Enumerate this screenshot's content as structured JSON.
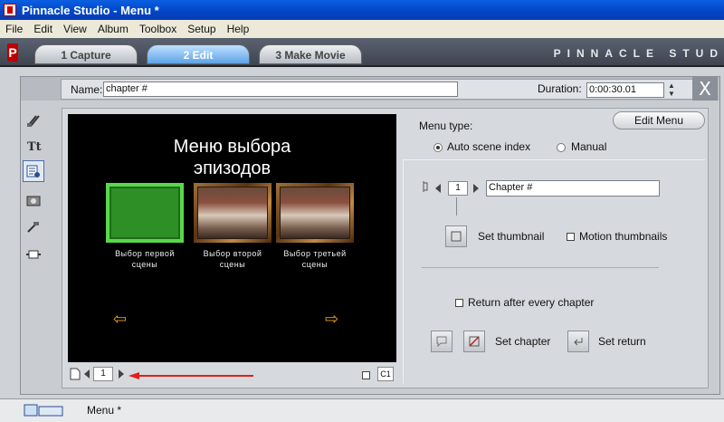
{
  "window": {
    "title": "Pinnacle Studio - Menu *"
  },
  "menubar": [
    "File",
    "Edit",
    "View",
    "Album",
    "Toolbox",
    "Setup",
    "Help"
  ],
  "tabs": [
    {
      "label": "1 Capture",
      "active": false
    },
    {
      "label": "2 Edit",
      "active": true
    },
    {
      "label": "3 Make Movie",
      "active": false
    }
  ],
  "brand": "PINNACLE STUD",
  "logo_letter": "P",
  "editor": {
    "name_label": "Name:",
    "name_value": "chapter #",
    "duration_label": "Duration:",
    "duration_value": "0:00:30.01",
    "close_glyph": "X"
  },
  "tools": [
    {
      "icon": "video-toolbox-icon"
    },
    {
      "icon": "title-toolbox-icon"
    },
    {
      "icon": "menu-toolbox-icon",
      "selected": true
    },
    {
      "icon": "photo-toolbox-icon"
    },
    {
      "icon": "audio-toolbox-icon"
    },
    {
      "icon": "effects-toolbox-icon"
    }
  ],
  "preview": {
    "title_line1": "Меню выбора",
    "title_line2": "эпизодов",
    "captions": [
      {
        "line1": "Выбор первой",
        "line2": "сцены"
      },
      {
        "line1": "Выбор второй",
        "line2": "сцены"
      },
      {
        "line1": "Выбор третьей",
        "line2": "сцены"
      }
    ],
    "page_number": "1",
    "chapter_badge": "C1"
  },
  "menu_settings": {
    "menu_type_label": "Menu type:",
    "edit_menu_button": "Edit Menu",
    "options": [
      {
        "label": "Auto scene index",
        "selected": true
      },
      {
        "label": "Manual",
        "selected": false
      }
    ]
  },
  "chapter": {
    "index": "1",
    "name_value": "Chapter #",
    "set_thumbnail": "Set thumbnail",
    "motion_thumbnails": "Motion thumbnails",
    "return_after_every_chapter": "Return after every chapter",
    "set_chapter": "Set chapter",
    "set_return": "Set return"
  },
  "timeline": {
    "label": "Menu *"
  },
  "colors": {
    "accent_blue": "#0a5fe0",
    "annotation_red": "#e0201a"
  }
}
